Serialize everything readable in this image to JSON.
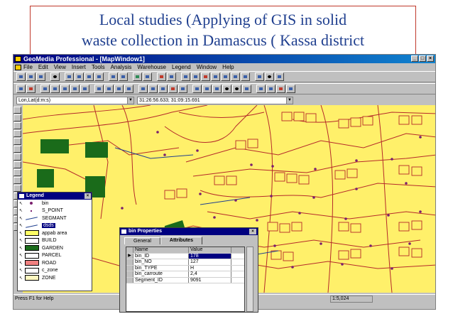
{
  "slide": {
    "title_line1": "Local studies (Applying of GIS in solid",
    "title_line2": "waste collection in Damascus ( Kassa district"
  },
  "window": {
    "title": "GeoMedia Professional - [MapWindow1]",
    "buttons": [
      "_",
      "□",
      "×"
    ]
  },
  "menubar": {
    "items": [
      "File",
      "Edit",
      "View",
      "Insert",
      "Tools",
      "Analysis",
      "Warehouse",
      "Legend",
      "Window",
      "Help"
    ]
  },
  "coordbar": {
    "format": "Lon,Lat(d:m:s)",
    "value": "31:26:56.633; 31:09:15.691"
  },
  "legend": {
    "title": "Legend",
    "close": "×",
    "entries": [
      {
        "label": "bin",
        "symbol": "dot"
      },
      {
        "label": "S_POINT",
        "symbol": "smalldot"
      },
      {
        "label": "SEGMANT",
        "symbol": "line"
      },
      {
        "label": "dsds",
        "symbol": "line",
        "selected": true
      },
      {
        "label": "appab area",
        "symbol": "box",
        "color": "#ffff66"
      },
      {
        "label": "BUILD",
        "symbol": "box",
        "color": "#ffffff"
      },
      {
        "label": "GARDEN",
        "symbol": "box",
        "color": "#1a6b1a"
      },
      {
        "label": "PARCEL",
        "symbol": "box",
        "color": "#ffffff"
      },
      {
        "label": "ROAD",
        "symbol": "box",
        "color": "#f08080"
      },
      {
        "label": "c_zone",
        "symbol": "box",
        "color": "#ffffff"
      },
      {
        "label": "ZONE",
        "symbol": "box",
        "color": "#fff8c0"
      }
    ]
  },
  "properties": {
    "title": "bin Properties",
    "close": "×",
    "tabs": [
      "General",
      "Attributes"
    ],
    "active_tab": "Attributes",
    "columns": [
      "Name",
      "Value"
    ],
    "rows": [
      {
        "name": "bin_ID",
        "value": "178"
      },
      {
        "name": "bin_NO",
        "value": "127"
      },
      {
        "name": "bin_TYPE",
        "value": "H"
      },
      {
        "name": "bin_carroute",
        "value": "2,4"
      },
      {
        "name": "Segment_ID",
        "value": "9091"
      }
    ]
  },
  "status": {
    "text": "Press F1 for Help",
    "scale": "1:5,024"
  },
  "colors": {
    "map_background": "#fff06a",
    "parcel_outline": "#b52a2a",
    "garden": "#1a6b1a",
    "bin_point": "#7a1f6e",
    "segment_line": "#1f3f8f"
  }
}
